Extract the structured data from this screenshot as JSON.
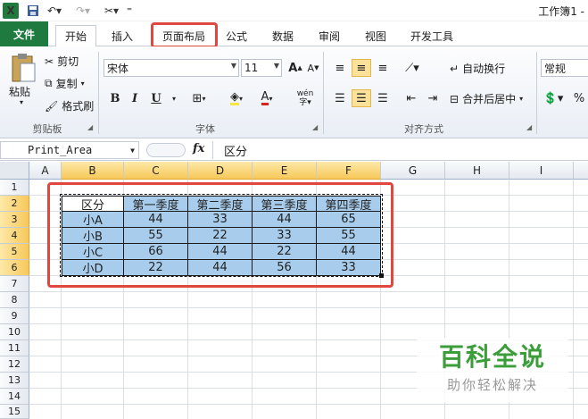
{
  "window": {
    "title": "工作簿1 -"
  },
  "tabs": [
    "文件",
    "开始",
    "插入",
    "页面布局",
    "公式",
    "数据",
    "审阅",
    "视图",
    "开发工具"
  ],
  "ribbon": {
    "clipboard": {
      "paste": "粘贴",
      "cut": "剪切",
      "copy": "复制",
      "format_painter": "格式刷",
      "label": "剪贴板"
    },
    "font": {
      "name": "宋体",
      "size": "11",
      "label": "字体",
      "bold": "B",
      "italic": "I",
      "underline": "U",
      "font_color_glyph": "A",
      "phonetic": "wén"
    },
    "alignment": {
      "wrap": "自动换行",
      "merge": "合并后居中",
      "label": "对齐方式"
    },
    "number": {
      "format": "常规",
      "percent": "%"
    }
  },
  "formula_bar": {
    "name_box": "Print_Area",
    "fx": "fx",
    "content": "区分"
  },
  "columns": [
    "A",
    "B",
    "C",
    "D",
    "E",
    "F",
    "G",
    "H",
    "I"
  ],
  "rows": [
    "1",
    "2",
    "3",
    "4",
    "5",
    "6",
    "7",
    "8",
    "9",
    "10",
    "11",
    "12",
    "13",
    "14",
    "15"
  ],
  "table": {
    "header": [
      "区分",
      "第一季度",
      "第二季度",
      "第三季度",
      "第四季度"
    ],
    "rows": [
      [
        "小A",
        "44",
        "33",
        "44",
        "65"
      ],
      [
        "小B",
        "55",
        "22",
        "33",
        "55"
      ],
      [
        "小C",
        "66",
        "44",
        "22",
        "44"
      ],
      [
        "小D",
        "22",
        "44",
        "56",
        "33"
      ]
    ]
  },
  "watermark": {
    "title": "百科全说",
    "subtitle": "助你轻松解决"
  },
  "colors": {
    "highlight": "#a8cdec",
    "annotation": "#e0473f",
    "file_tab": "#1e7a3e",
    "selected_header": "#f7c85a"
  }
}
